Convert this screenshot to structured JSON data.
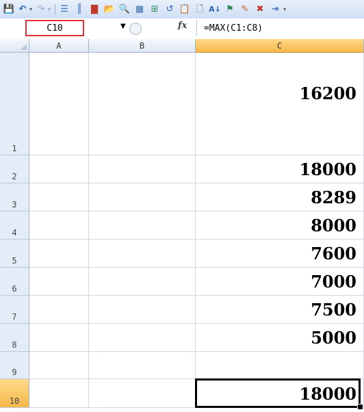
{
  "formula_bar": {
    "name_box": "C10",
    "fx_label": "fx",
    "formula": "=MAX(C1:C8)"
  },
  "columns": [
    "A",
    "B",
    "C"
  ],
  "rows": [
    {
      "num": "1",
      "c": "16200"
    },
    {
      "num": "2",
      "c": "18000"
    },
    {
      "num": "3",
      "c": "8289"
    },
    {
      "num": "4",
      "c": "8000"
    },
    {
      "num": "5",
      "c": "7600"
    },
    {
      "num": "6",
      "c": "7000"
    },
    {
      "num": "7",
      "c": "7500"
    },
    {
      "num": "8",
      "c": "5000"
    },
    {
      "num": "9",
      "c": ""
    },
    {
      "num": "10",
      "c": "18000"
    }
  ],
  "icons": [
    "save-icon",
    "undo-icon",
    "redo-icon",
    "insert-rows-icon",
    "insert-columns-icon",
    "chart-icon",
    "open-folder-icon",
    "print-preview-icon",
    "table-icon",
    "pivot-icon",
    "refresh-icon",
    "paste-icon",
    "new-icon",
    "sort-icon",
    "format-icon",
    "edit-icon",
    "clear-icon",
    "delete-icon"
  ]
}
